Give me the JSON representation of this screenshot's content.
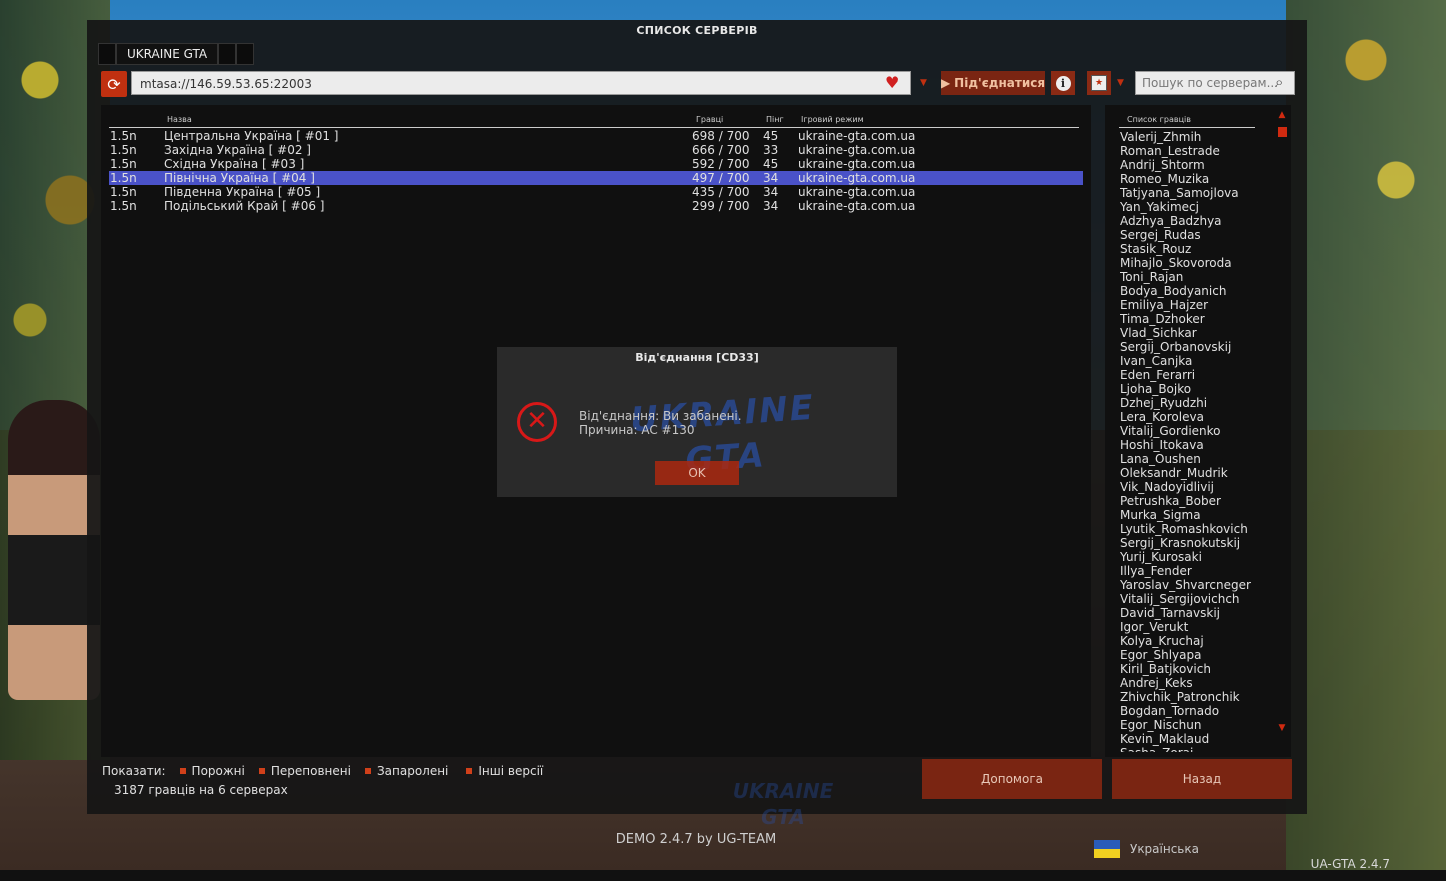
{
  "window": {
    "title": "СПИСОК СЕРВЕРІВ"
  },
  "tabs": [
    {
      "label": "UKRAINE GTA"
    }
  ],
  "toolbar": {
    "address": "mtasa://146.59.53.65:22003",
    "connect_label": "Під'єднатися",
    "search_placeholder": "Пошук по серверам..."
  },
  "list": {
    "columns": {
      "name": "Назва",
      "players": "Гравці",
      "ping": "Пінг",
      "mode": "Ігровий режим"
    },
    "rows": [
      {
        "ver": "1.5n",
        "name": "Центральна Україна [ #01 ]",
        "players": "698 / 700",
        "ping": "45",
        "mode": "ukraine-gta.com.ua"
      },
      {
        "ver": "1.5n",
        "name": "Західна Україна [ #02 ]",
        "players": "666 / 700",
        "ping": "33",
        "mode": "ukraine-gta.com.ua"
      },
      {
        "ver": "1.5n",
        "name": "Східна Україна [ #03 ]",
        "players": "592 / 700",
        "ping": "45",
        "mode": "ukraine-gta.com.ua"
      },
      {
        "ver": "1.5n",
        "name": "Північна Україна [ #04 ]",
        "players": "497 / 700",
        "ping": "34",
        "mode": "ukraine-gta.com.ua",
        "selected": true
      },
      {
        "ver": "1.5n",
        "name": "Південна Україна [ #05 ]",
        "players": "435 / 700",
        "ping": "34",
        "mode": "ukraine-gta.com.ua"
      },
      {
        "ver": "1.5n",
        "name": "Подільський Край [ #06 ]",
        "players": "299 / 700",
        "ping": "34",
        "mode": "ukraine-gta.com.ua"
      }
    ]
  },
  "players": {
    "header": "Список гравців",
    "names": [
      "Valerij_Zhmih",
      "Roman_Lestrade",
      "Andrij_Shtorm",
      "Romeo_Muzika",
      "Tatjyana_Samojlova",
      "Yan_Yakimecj",
      "Adzhya_Badzhya",
      "Sergej_Rudas",
      "Stasik_Rouz",
      "Mihajlo_Skovoroda",
      "Toni_Rajan",
      "Bodya_Bodyanich",
      "Emiliya_Hajzer",
      "Tima_Dzhoker",
      "Vlad_Sichkar",
      "Sergij_Orbanovskij",
      "Ivan_Canjka",
      "Eden_Ferarri",
      "Ljoha_Bojko",
      "Dzhej_Ryudzhi",
      "Lera_Koroleva",
      "Vitalij_Gordienko",
      "Hoshi_Itokava",
      "Lana_Oushen",
      "Oleksandr_Mudrik",
      "Vik_Nadoyidlivij",
      "Petrushka_Bober",
      "Murka_Sigma",
      "Lyutik_Romashkovich",
      "Sergij_Krasnokutskij",
      "Yurij_Kurosaki",
      "Illya_Fender",
      "Yaroslav_Shvarcneger",
      "Vitalij_Sergijovichch",
      "David_Tarnavskij",
      "Igor_Verukt",
      "Kolya_Kruchaj",
      "Egor_Shlyapa",
      "Kiril_Batjkovich",
      "Andrej_Keks",
      "Zhivchik_Patronchik",
      "Bogdan_Tornado",
      "Egor_Nischun",
      "Kevin_Maklaud",
      "Sasha_Zorai"
    ]
  },
  "filters": {
    "label": "Показати:",
    "options": [
      "Порожні",
      "Переповнені",
      "Запаролені",
      "Інші версії"
    ]
  },
  "status": {
    "count_text": "3187 гравців на 6 серверах"
  },
  "buttons": {
    "help": "Допомога",
    "back": "Назад"
  },
  "dialog": {
    "title": "Від'єднання [CD33]",
    "line1": "Від'єднання: Ви забанені.",
    "line2": "Причина: AC #130",
    "ok": "OK",
    "logo_line1": "UKRAINE",
    "logo_line2": "GTA"
  },
  "watermark": {
    "line1": "UKRAINE",
    "line2": "GTA"
  },
  "footer": {
    "text": "DEMO 2.4.7 by UG-TEAM",
    "language": "Українська",
    "version": "UA-GTA 2.4.7"
  },
  "colors": {
    "accent": "#7a2512",
    "selected_row": "#4a52c8",
    "error": "#d81818"
  }
}
